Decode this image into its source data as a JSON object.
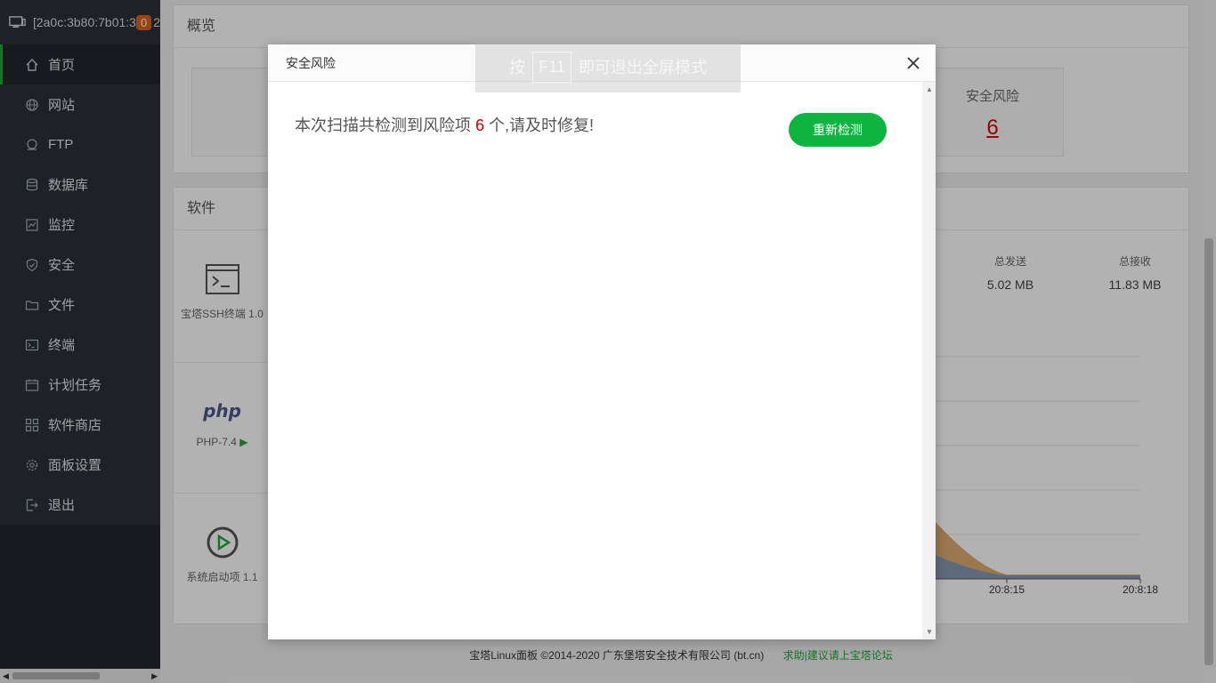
{
  "sidebar": {
    "server_label": "[2a0c:3b80:7b01:3",
    "server_extra": "2",
    "badge": "0",
    "items": [
      {
        "label": "首页",
        "icon": "home-icon"
      },
      {
        "label": "网站",
        "icon": "globe-icon"
      },
      {
        "label": "FTP",
        "icon": "ftp-icon"
      },
      {
        "label": "数据库",
        "icon": "database-icon"
      },
      {
        "label": "监控",
        "icon": "monitor-icon"
      },
      {
        "label": "安全",
        "icon": "shield-icon"
      },
      {
        "label": "文件",
        "icon": "folder-icon"
      },
      {
        "label": "终端",
        "icon": "terminal-icon"
      },
      {
        "label": "计划任务",
        "icon": "calendar-icon"
      },
      {
        "label": "软件商店",
        "icon": "grid-icon"
      },
      {
        "label": "面板设置",
        "icon": "gear-icon"
      },
      {
        "label": "退出",
        "icon": "logout-icon"
      }
    ]
  },
  "overview": {
    "title": "概览",
    "risk_label": "安全风险",
    "risk_count": "6"
  },
  "software": {
    "title": "软件",
    "items": [
      {
        "label": "宝塔SSH终端 1.0"
      },
      {
        "label": "PHP-7.4"
      },
      {
        "label": "系统启动项 1.1"
      }
    ]
  },
  "traffic": {
    "sent_label": "总发送",
    "sent_value": "5.02 MB",
    "recv_label": "总接收",
    "recv_value": "11.83 MB",
    "x_ticks": [
      "20:8:15",
      "20:8:18"
    ]
  },
  "footer": {
    "copyright": "宝塔Linux面板 ©2014-2020 广东堡塔安全技术有限公司 (bt.cn)",
    "link": "求助|建议请上宝塔论坛"
  },
  "fullscreen_hint": {
    "prefix": "按",
    "key": "F11",
    "suffix": "即可退出全屏模式"
  },
  "dialog": {
    "title": "安全风险",
    "msg_prefix": "本次扫描共检测到风险项 ",
    "count": "6",
    "msg_suffix": " 个,请及时修复!",
    "recheck_label": "重新检测"
  },
  "colors": {
    "accent": "#20a53a",
    "button": "#0db540",
    "danger": "#d60000",
    "sidebar_bg": "#2c3138"
  }
}
